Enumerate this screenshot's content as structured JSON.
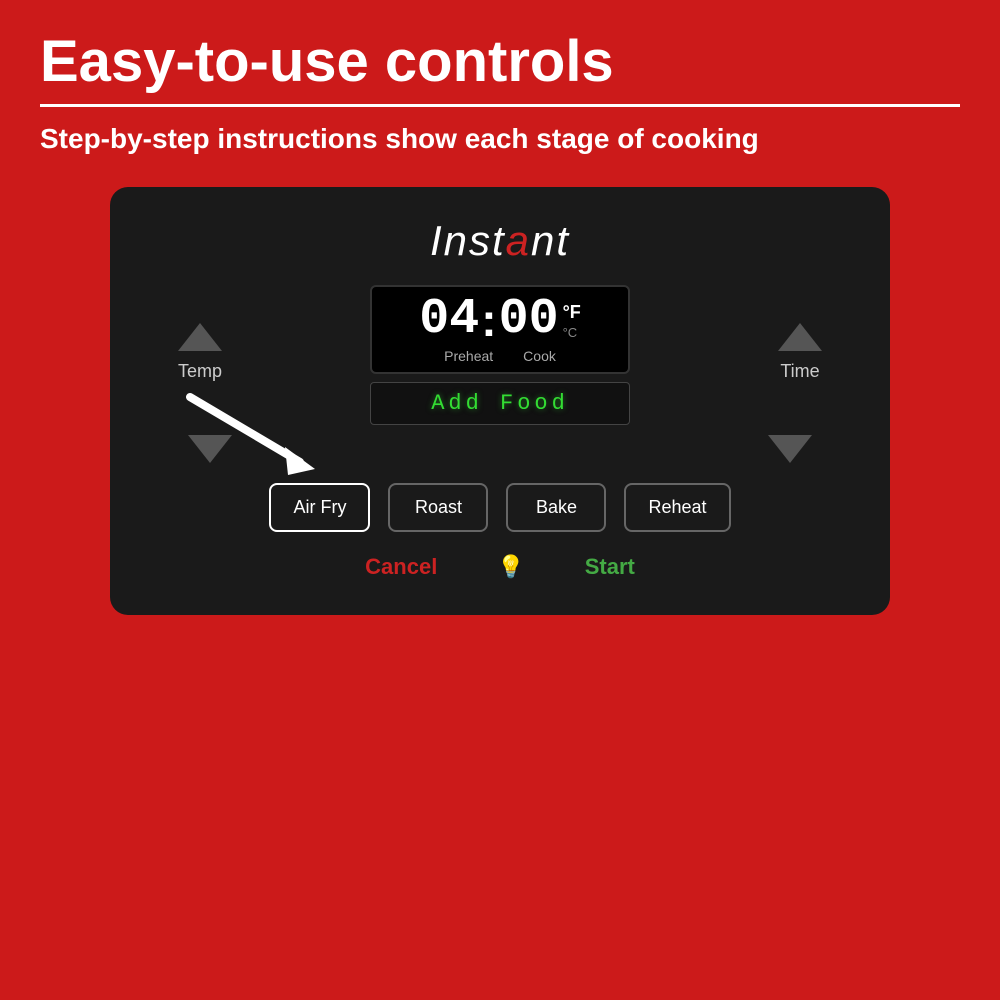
{
  "page": {
    "title": "Easy-to-use controls",
    "subtitle": "Step-by-step instructions show each stage of cooking",
    "divider": true
  },
  "brand": {
    "name_part1": "Inst",
    "name_a": "a",
    "name_part2": "nt"
  },
  "display": {
    "time": "04:00",
    "digit1": "0",
    "digit2": "4",
    "digit3": "0",
    "digit4": "0",
    "unit_f": "°F",
    "unit_c": "°C",
    "preheat_label": "Preheat",
    "cook_label": "Cook",
    "add_food": "Add Food"
  },
  "controls": {
    "temp_label": "Temp",
    "time_label": "Time"
  },
  "buttons": [
    {
      "id": "air-fry",
      "label": "Air Fry",
      "active": true
    },
    {
      "id": "roast",
      "label": "Roast",
      "active": false
    },
    {
      "id": "bake",
      "label": "Bake",
      "active": false
    },
    {
      "id": "reheat",
      "label": "Reheat",
      "active": false
    }
  ],
  "actions": {
    "cancel_label": "Cancel",
    "start_label": "Start",
    "light_icon": "💡"
  },
  "colors": {
    "background": "#cc1a1a",
    "panel": "#1a1a1a",
    "cancel": "#cc2222",
    "start": "#44aa44",
    "display_green": "#33dd33"
  }
}
